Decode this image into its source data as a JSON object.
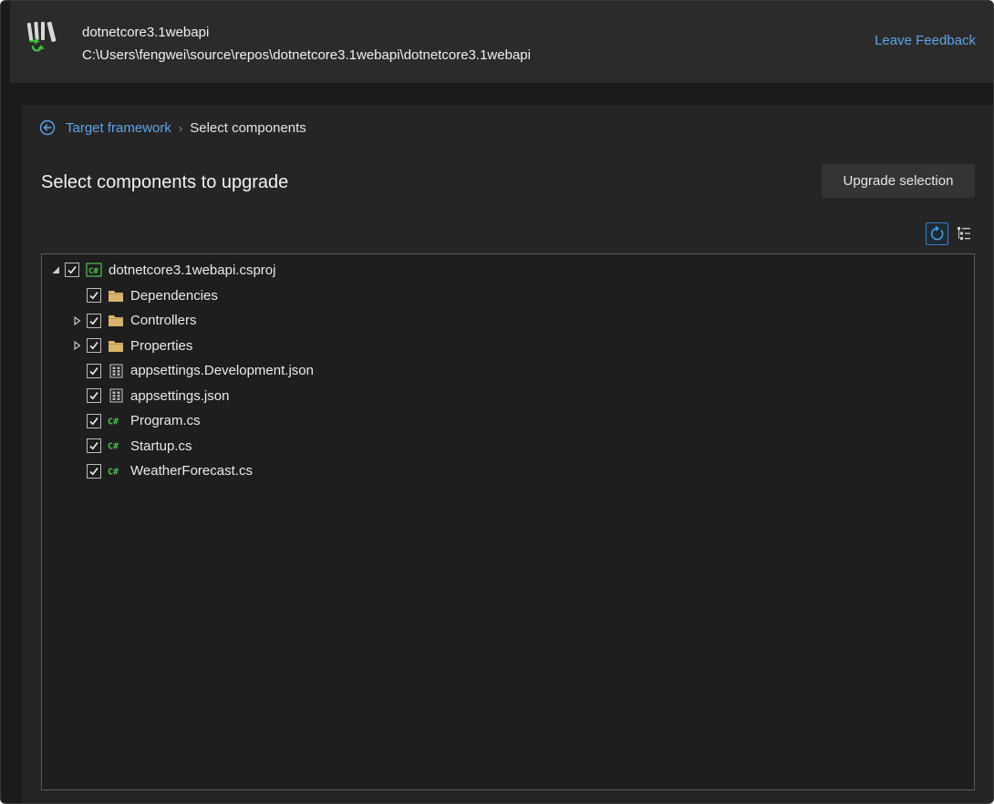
{
  "header": {
    "project_name": "dotnetcore3.1webapi",
    "project_path": "C:\\Users\\fengwei\\source\\repos\\dotnetcore3.1webapi\\dotnetcore3.1webapi",
    "feedback_label": "Leave Feedback",
    "logo_icon": "upgrade-assistant-logo-icon"
  },
  "breadcrumb": {
    "back_icon": "back-arrow-circle-icon",
    "previous": "Target framework",
    "separator": "›",
    "current": "Select components"
  },
  "page": {
    "title": "Select components to upgrade",
    "upgrade_button": "Upgrade selection",
    "refresh_icon": "refresh-icon",
    "options_icon": "tree-options-icon"
  },
  "tree": {
    "root": {
      "label": "dotnetcore3.1webapi.csproj",
      "icon": "csharp-project-icon",
      "checked": true,
      "expanded": true
    },
    "items": [
      {
        "label": "Dependencies",
        "icon": "folder-icon",
        "checked": true,
        "expandable": false
      },
      {
        "label": "Controllers",
        "icon": "folder-icon",
        "checked": true,
        "expandable": true
      },
      {
        "label": "Properties",
        "icon": "folder-icon",
        "checked": true,
        "expandable": true
      },
      {
        "label": "appsettings.Development.json",
        "icon": "json-file-icon",
        "checked": true,
        "expandable": false
      },
      {
        "label": "appsettings.json",
        "icon": "json-file-icon",
        "checked": true,
        "expandable": false
      },
      {
        "label": "Program.cs",
        "icon": "csharp-file-icon",
        "checked": true,
        "expandable": false
      },
      {
        "label": "Startup.cs",
        "icon": "csharp-file-icon",
        "checked": true,
        "expandable": false
      },
      {
        "label": "WeatherForecast.cs",
        "icon": "csharp-file-icon",
        "checked": true,
        "expandable": false
      }
    ]
  },
  "colors": {
    "accent_link": "#5fa4e6",
    "folder": "#d8b46c",
    "csharp": "#4fc24f",
    "background": "#1b1b1b"
  }
}
